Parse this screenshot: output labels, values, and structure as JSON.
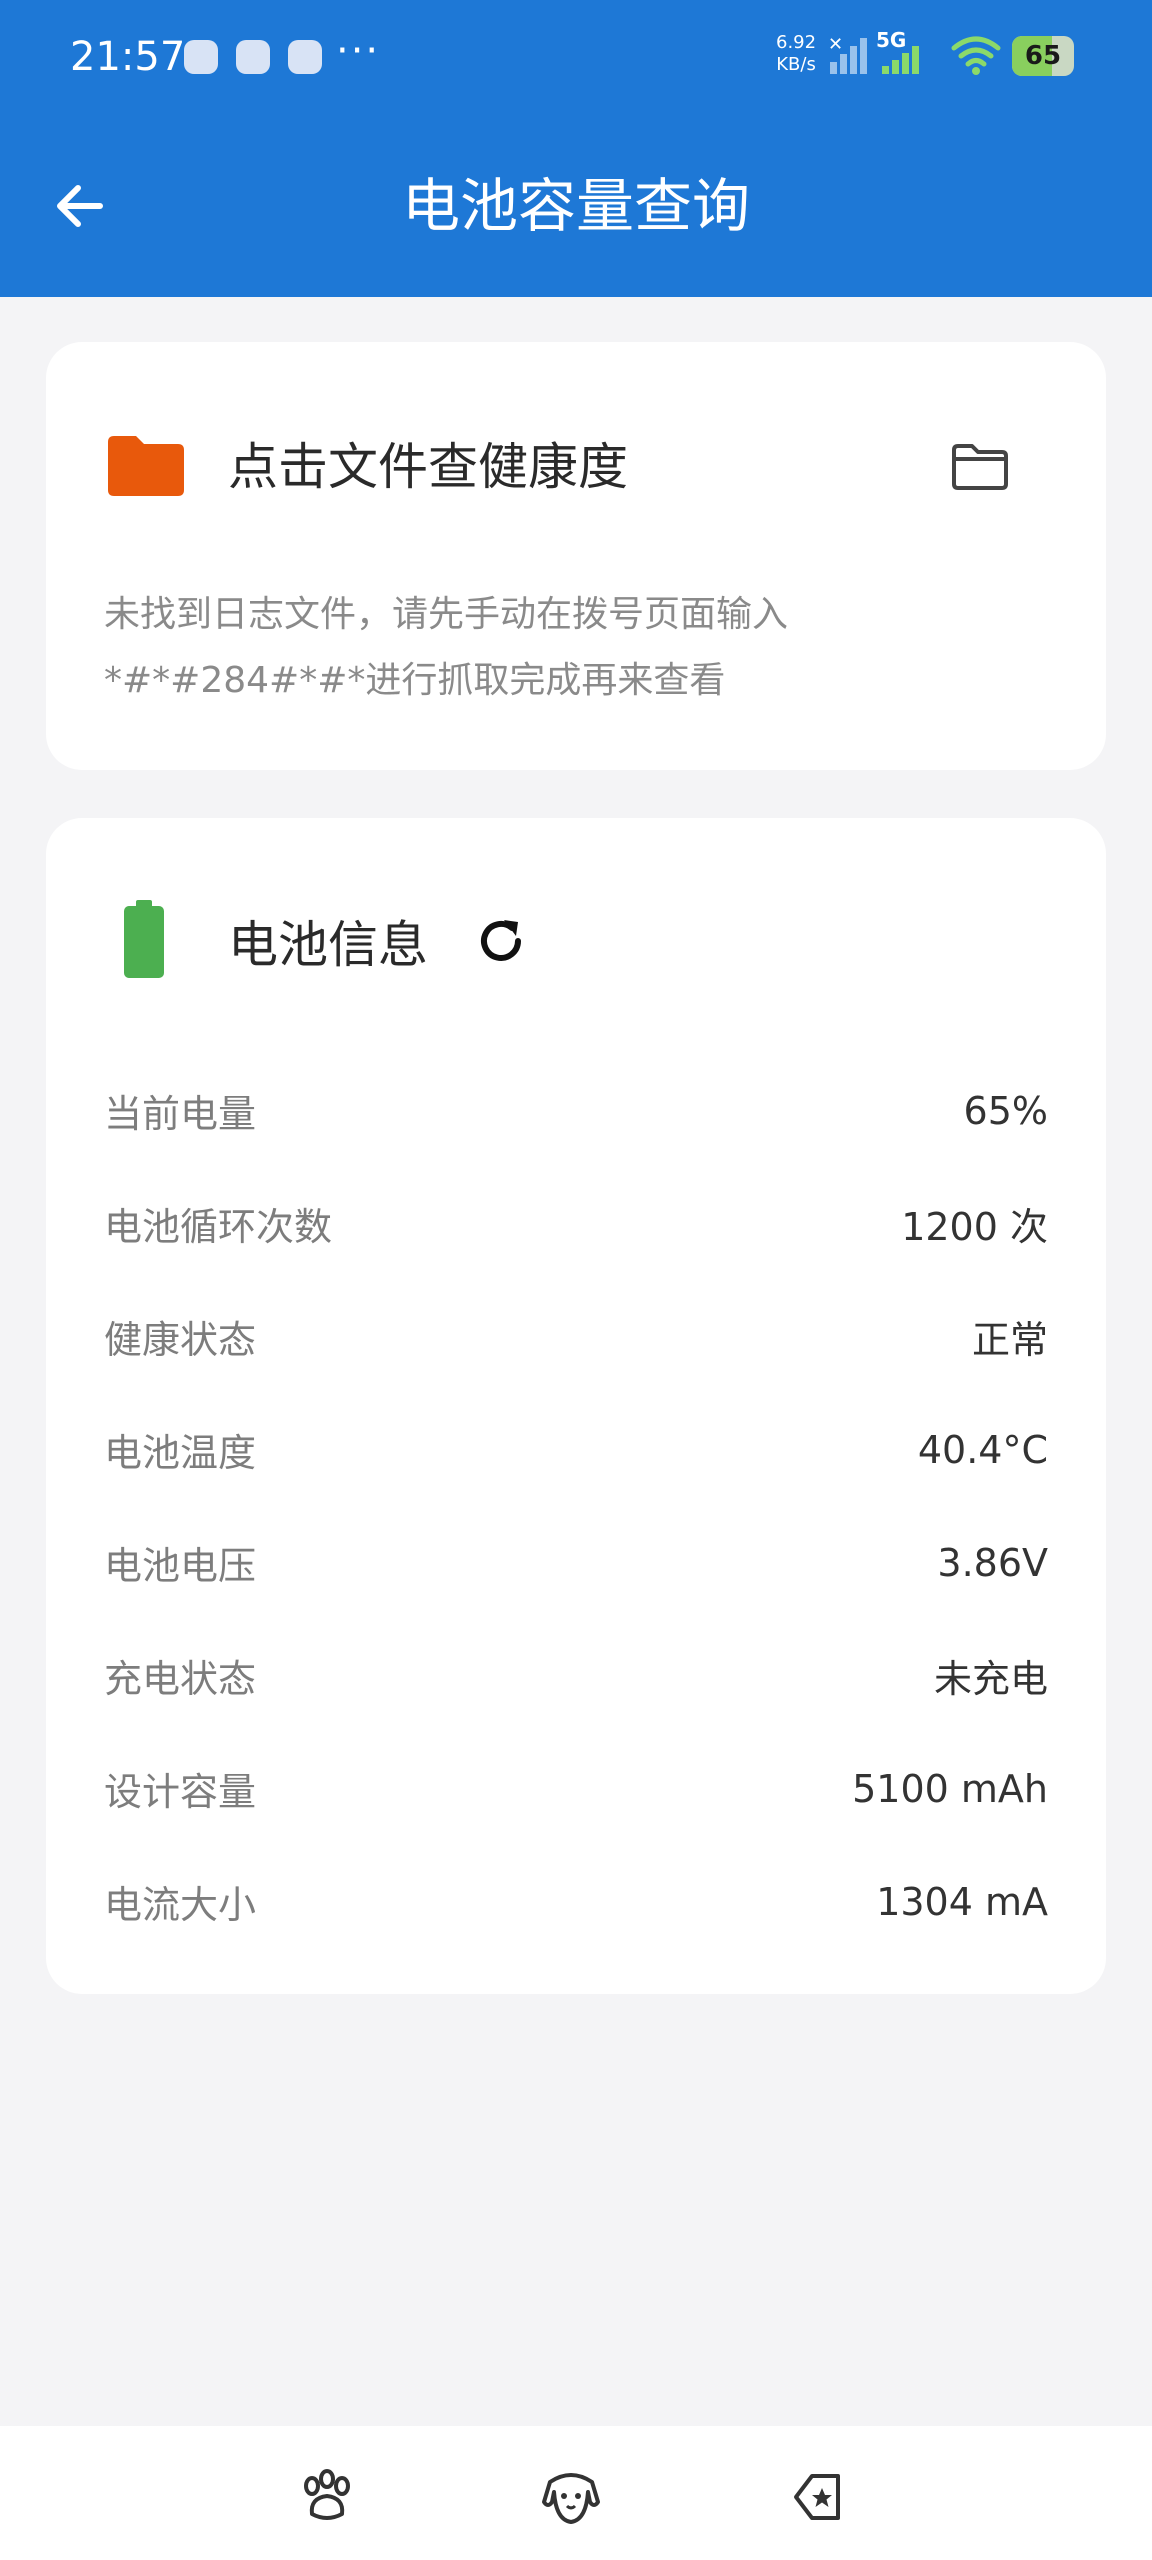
{
  "status_bar": {
    "time": "21:57",
    "net_speed_value": "6.92",
    "net_speed_unit": "KB/s",
    "network_type": "5G",
    "battery_percent": "65",
    "battery_level": 0.65,
    "more": "···"
  },
  "header": {
    "title": "电池容量查询",
    "back_icon": "arrow-left-icon"
  },
  "file_card": {
    "title": "点击文件查健康度",
    "icon": "folder-icon",
    "action_icon": "folder-outline-icon",
    "note_line1": "未找到日志文件，请先手动在拨号页面输入",
    "note_line2": "*#*#284#*#*进行抓取完成再来查看",
    "accent": "#e8590c"
  },
  "battery_card": {
    "title": "电池信息",
    "icon": "battery-icon",
    "refresh_icon": "refresh-icon",
    "accent": "#4caf50",
    "rows": [
      {
        "label": "当前电量",
        "value": "65%"
      },
      {
        "label": "电池循环次数",
        "value": "1200 次"
      },
      {
        "label": "健康状态",
        "value": "正常"
      },
      {
        "label": "电池温度",
        "value": "40.4°C"
      },
      {
        "label": "电池电压",
        "value": "3.86V"
      },
      {
        "label": "充电状态",
        "value": "未充电"
      },
      {
        "label": "设计容量",
        "value": "5100 mAh"
      },
      {
        "label": "电流大小",
        "value": "1304 mA"
      }
    ]
  },
  "bottom_nav": {
    "items": [
      {
        "icon": "paw-icon"
      },
      {
        "icon": "dog-icon"
      },
      {
        "icon": "star-tag-icon"
      }
    ]
  },
  "colors": {
    "appbar": "#1e78d6",
    "background": "#f4f4f6"
  }
}
